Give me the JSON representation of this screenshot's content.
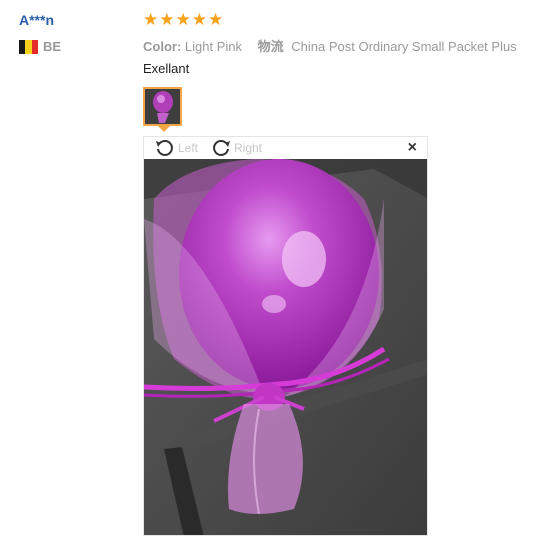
{
  "review": {
    "user_name": "A***n",
    "country_code": "BE",
    "flag_colors": [
      "#1a1a1a",
      "#f6d21d",
      "#e42c2c"
    ],
    "rating": 5,
    "star_glyph": "★",
    "star_color": "#f7a21c",
    "attributes": {
      "color_label": "Color:",
      "color_value": "Light Pink",
      "shipping_label": "物流",
      "shipping_value": "China Post Ordinary Small Packet Plus"
    },
    "text": "Exellant"
  },
  "viewer": {
    "rotate_left_label": "Left",
    "rotate_right_label": "Right",
    "close_glyph": "×",
    "accent_color": "#f0a646"
  }
}
